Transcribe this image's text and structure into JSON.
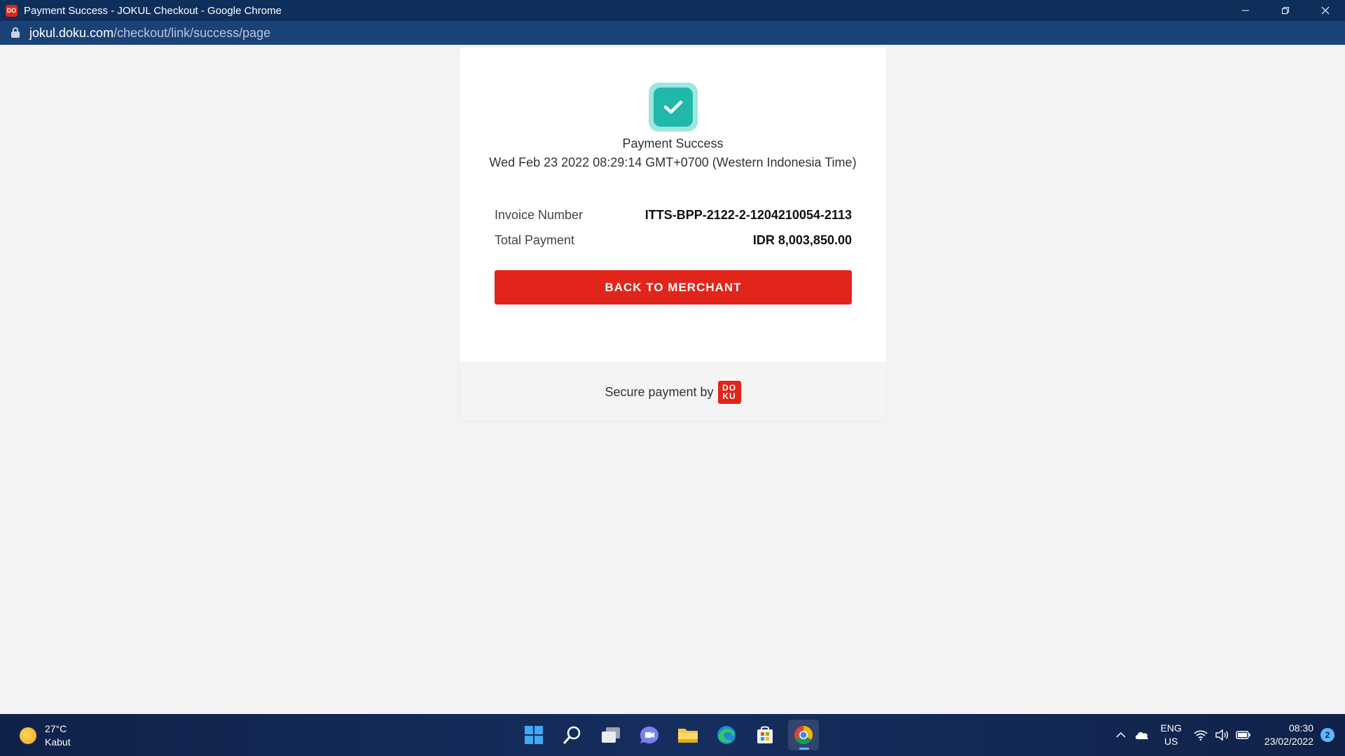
{
  "browser": {
    "window_title": "Payment Success - JOKUL Checkout - Google Chrome",
    "favicon_text": "DO",
    "url_domain": "jokul.doku.com",
    "url_path": "/checkout/link/success/page",
    "controls": {
      "minimize_icon": "minimize-icon",
      "restore_icon": "restore-icon",
      "close_icon": "close-icon"
    }
  },
  "payment": {
    "status_icon": "check-icon",
    "status_title": "Payment Success",
    "timestamp": "Wed Feb 23 2022 08:29:14 GMT+0700 (Western Indonesia Time)",
    "invoice_label": "Invoice Number",
    "invoice_value": "ITTS-BPP-2122-2-1204210054-2113",
    "total_label": "Total Payment",
    "total_value": "IDR 8,003,850.00",
    "button_label": "BACK TO MERCHANT",
    "footer_text": "Secure payment by",
    "logo_line1": "DO",
    "logo_line2": "KU"
  },
  "colors": {
    "brand_red": "#e1251b",
    "success_teal": "#1fb8aa",
    "titlebar": "#0f2f5b",
    "addressbar": "#1b4276"
  },
  "taskbar": {
    "weather_temp": "27°C",
    "weather_desc": "Kabut",
    "apps": [
      "windows-start-icon",
      "search-icon",
      "task-view-icon",
      "teams-chat-icon",
      "file-explorer-icon",
      "edge-icon",
      "store-icon",
      "chrome-icon"
    ],
    "lang_line1": "ENG",
    "lang_line2": "US",
    "time": "08:30",
    "date": "23/02/2022",
    "notification_count": "2"
  }
}
